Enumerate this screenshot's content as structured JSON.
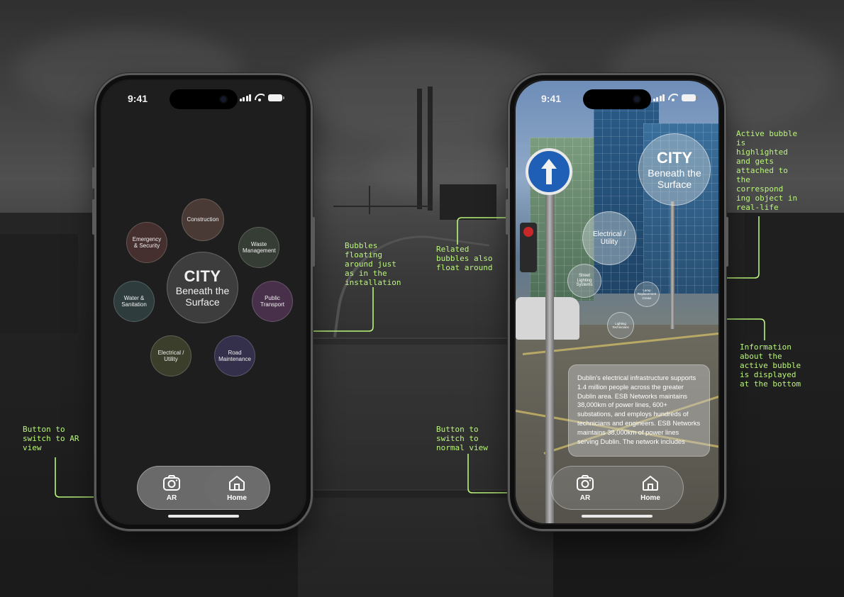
{
  "accent_color": "#b9f57a",
  "left_phone": {
    "status_time": "9:41",
    "center_bubble": {
      "title": "CITY",
      "subtitle": "Beneath the Surface"
    },
    "bubbles": [
      {
        "label": "Construction",
        "color": "#4a3a36"
      },
      {
        "label": "Waste Management",
        "color": "#363d34"
      },
      {
        "label": "Public Transport",
        "color": "#48304a"
      },
      {
        "label": "Road Maintenance",
        "color": "#34304c"
      },
      {
        "label": "Electrical / Utility",
        "color": "#3c3e2c"
      },
      {
        "label": "Water & Sanitation",
        "color": "#2e3c3e"
      },
      {
        "label": "Emergency & Security",
        "color": "#45302f"
      }
    ],
    "nav": {
      "ar_label": "AR",
      "home_label": "Home",
      "active": "Home"
    }
  },
  "right_phone": {
    "status_time": "9:41",
    "active_bubble": {
      "title": "CITY",
      "subtitle": "Beneath the Surface"
    },
    "related_bubbles": [
      {
        "label": "Electrical / Utility"
      },
      {
        "label": "Street Lighting Systems"
      },
      {
        "label": "Lamp Replacement Crews"
      },
      {
        "label": "Lighting Technicians"
      }
    ],
    "info_text": "Dublin's electrical infrastructure supports 1.4 million people across the greater Dublin area. ESB Networks maintains 38,000km of power lines, 600+ substations, and employs hundreds of technicians and engineers. ESB Networks maintains 38,000km of power lines serving Dublin. The network includes",
    "nav": {
      "ar_label": "AR",
      "home_label": "Home",
      "active": "AR"
    }
  },
  "annotations": {
    "bubbles_floating": "Bubbles floating around just as in the installation",
    "switch_to_ar": "Button to switch to AR view",
    "related_bubbles": "Related bubbles also float around",
    "active_bubble": "Active bubble is highlighted and gets attached to the correspond ing object in real-life",
    "info_bottom": "Information about the active bubble is displayed at the bottom",
    "switch_to_normal": "Button to switch to normal view"
  }
}
